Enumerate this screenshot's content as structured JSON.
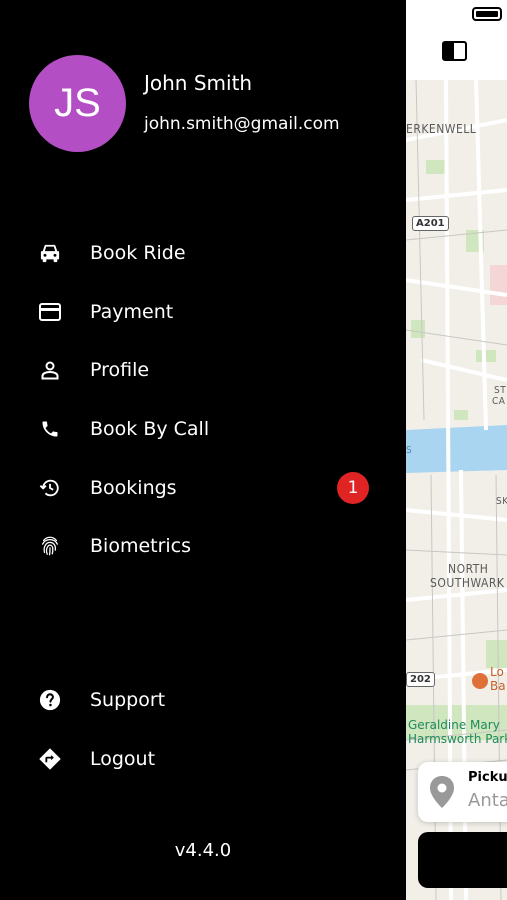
{
  "user": {
    "initials": "JS",
    "name": "John Smith",
    "email": "john.smith@gmail.com",
    "avatar_color": "#b44ec4"
  },
  "menu": {
    "items": [
      {
        "label": "Book Ride",
        "icon": "car-icon"
      },
      {
        "label": "Payment",
        "icon": "credit-card-icon"
      },
      {
        "label": "Profile",
        "icon": "person-icon"
      },
      {
        "label": "Book By Call",
        "icon": "phone-icon"
      },
      {
        "label": "Bookings",
        "icon": "history-icon",
        "badge": "1"
      },
      {
        "label": "Biometrics",
        "icon": "fingerprint-icon"
      }
    ],
    "footer_items": [
      {
        "label": "Support",
        "icon": "help-circle-icon"
      },
      {
        "label": "Logout",
        "icon": "directions-icon"
      }
    ]
  },
  "version": "v4.4.0",
  "badge_color": "#e02424",
  "map": {
    "labels": {
      "clerkenwell": "ERKENWELL",
      "north": "NORTH",
      "southwark": "SOUTHWARK",
      "st": "ST",
      "ca": "CA",
      "s": "S",
      "sk": "SK"
    },
    "roads": {
      "a201": "A201",
      "a202": "202"
    },
    "pois": {
      "geraldine_line1": "Geraldine Mary",
      "geraldine_line2": "Harmsworth Park",
      "lo_line1": "Lo",
      "lo_line2": "Ba"
    }
  },
  "pickup": {
    "label": "Pickup",
    "value": "Anta"
  }
}
